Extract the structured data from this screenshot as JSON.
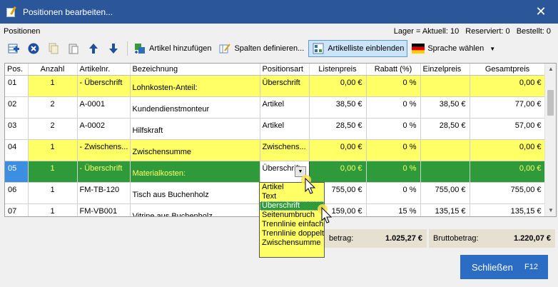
{
  "window": {
    "title": "Positionen bearbeiten...",
    "close_glyph": "✕"
  },
  "info": {
    "section": "Positionen",
    "lager": "Lager = Aktuell: 10",
    "reserviert": "Reserviert: 0",
    "bestellt": "Bestellt: 0"
  },
  "toolbar": {
    "add_article": "Artikel hinzufügen",
    "define_columns": "Spalten definieren...",
    "show_article_list": "Artikelliste einblenden",
    "choose_language": "Sprache wählen"
  },
  "grid": {
    "columns": [
      "Pos.",
      "Anzahl",
      "Artikelnr.",
      "Bezeichnung",
      "Positionsart",
      "Listenpreis",
      "Rabatt (%)",
      "Einzelpreis",
      "Gesamtpreis"
    ],
    "rows": [
      {
        "pos": "01",
        "anzahl": "1",
        "artikelnr": "- Überschrift",
        "bezeichnung": "Lohnkosten-Anteil:",
        "art": "Überschrift",
        "listenpreis": "0,00 €",
        "rabatt": "0 %",
        "einzelpreis": "",
        "gesamtpreis": "0,00 €"
      },
      {
        "pos": "02",
        "anzahl": "2",
        "artikelnr": "A-0001",
        "bezeichnung": "Kundendienstmonteur",
        "art": "Artikel",
        "listenpreis": "38,50 €",
        "rabatt": "0 %",
        "einzelpreis": "38,50 €",
        "gesamtpreis": "77,00 €"
      },
      {
        "pos": "03",
        "anzahl": "2",
        "artikelnr": "A-0002",
        "bezeichnung": "Hilfskraft",
        "art": "Artikel",
        "listenpreis": "28,50 €",
        "rabatt": "0 %",
        "einzelpreis": "28,50 €",
        "gesamtpreis": "57,00 €"
      },
      {
        "pos": "04",
        "anzahl": "1",
        "artikelnr": "- Zwischens...",
        "bezeichnung": "Zwischensumme",
        "art": "Zwischens...",
        "listenpreis": "0,00 €",
        "rabatt": "0 %",
        "einzelpreis": "",
        "gesamtpreis": "0,00 €"
      },
      {
        "pos": "05",
        "anzahl": "1",
        "artikelnr": "- Überschrift",
        "bezeichnung": "Materialkosten:",
        "art": "Überschrift",
        "listenpreis": "0,00 €",
        "rabatt": "0 %",
        "einzelpreis": "",
        "gesamtpreis": "0,00 €"
      },
      {
        "pos": "06",
        "anzahl": "1",
        "artikelnr": "FM-TB-120",
        "bezeichnung": "Tisch aus Buchenholz",
        "art": "",
        "listenpreis": "755,00 €",
        "rabatt": "0 %",
        "einzelpreis": "755,00 €",
        "gesamtpreis": "755,00 €"
      },
      {
        "pos": "07",
        "anzahl": "1",
        "artikelnr": "FM-VB001",
        "bezeichnung": "Vitrine aus Buchenholz",
        "art": "",
        "listenpreis": "159,00 €",
        "rabatt": "15 %",
        "einzelpreis": "135,15 €",
        "gesamtpreis": "135,15 €"
      }
    ]
  },
  "dropdown": {
    "options": [
      "Artikel",
      "Text",
      "Überschrift",
      "Seitenumbruch",
      "Trennlinie einfach",
      "Trennlinie doppelt",
      "Zwischensumme"
    ],
    "selected": "Überschrift"
  },
  "totals": {
    "net_label_fragment": "betrag:",
    "net_value": "1.025,27 €",
    "gross_label": "Bruttobetrag:",
    "gross_value": "1.220,07 €"
  },
  "footer": {
    "close_label": "Schließen",
    "close_key": "F12"
  },
  "colors": {
    "titlebar": "#2b579a",
    "heading_row": "#ffff66",
    "selected_row": "#2f9a3a",
    "primary_button": "#2b6cc4"
  }
}
